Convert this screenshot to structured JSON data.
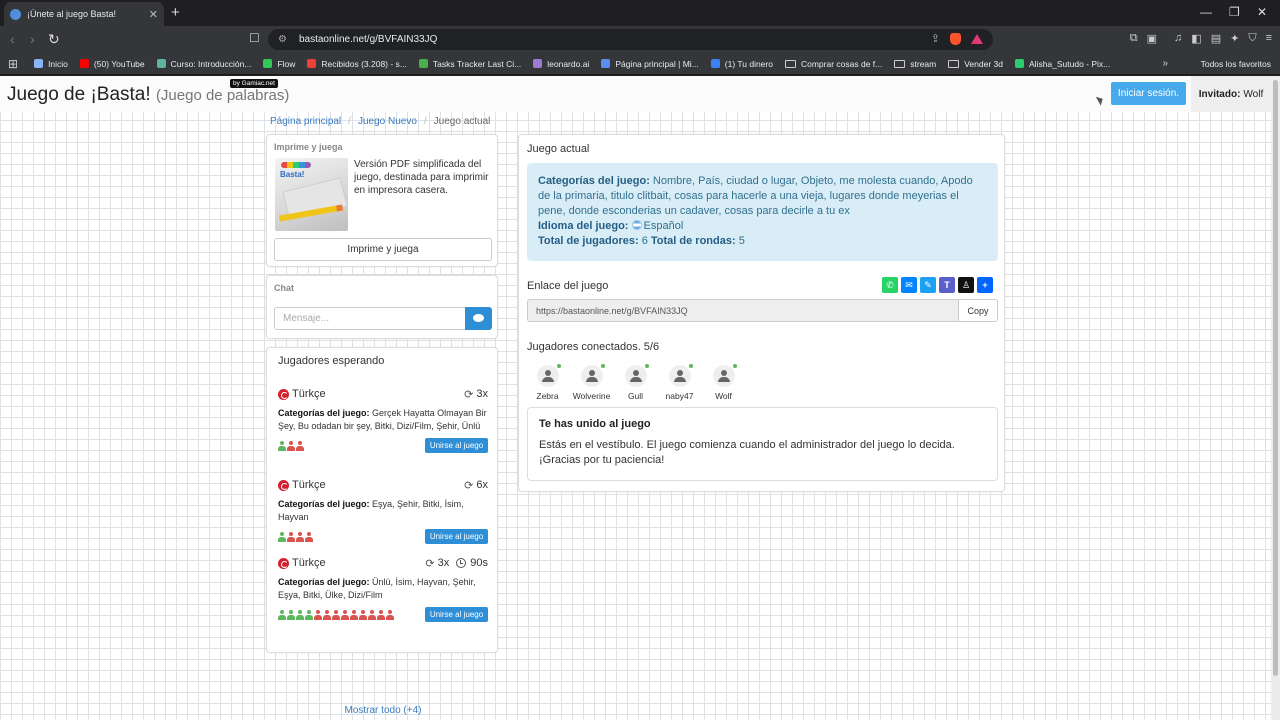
{
  "browser": {
    "tab_title": "¡Únete al juego Basta!",
    "url": "bastaonline.net/g/BVFAIN33JQ",
    "bookmarks": [
      {
        "label": "Inicio",
        "color": "#8ab4f8"
      },
      {
        "label": "(50) YouTube",
        "color": "#ff0000"
      },
      {
        "label": "Curso: Introducción...",
        "color": "#5fb3a1"
      },
      {
        "label": "Flow",
        "color": "#34c759"
      },
      {
        "label": "Recibidos (3.208) - s...",
        "color": "#ea4335"
      },
      {
        "label": "Tasks Tracker Last Ci...",
        "color": "#4caf50"
      },
      {
        "label": "leonardo.ai",
        "color": "#9b7bd4"
      },
      {
        "label": "Página principal | Mi...",
        "color": "#5b8def"
      },
      {
        "label": "(1) Tu dinero",
        "color": "#3b82f6"
      },
      {
        "label": "Comprar cosas de f...",
        "color": ""
      },
      {
        "label": "stream",
        "color": ""
      },
      {
        "label": "Vender 3d",
        "color": ""
      },
      {
        "label": "Alisha_Sutudo - Pix...",
        "color": "#2ecc71"
      }
    ],
    "all_bookmarks": "Todos los favoritos"
  },
  "header": {
    "title": "Juego de ¡Basta!",
    "subtitle": "(Juego de palabras)",
    "badge": "by Gamiac.net",
    "login_label": "Iniciar sesión.",
    "guest_label": "Invitado:",
    "guest_name": "Wolf"
  },
  "breadcrumb": {
    "home": "Página principal",
    "new_game": "Juego Nuevo",
    "current": "Juego actual"
  },
  "print_panel": {
    "title": "Imprime y juega",
    "description": "Versión PDF simplificada del juego, destinada para imprimir en impresora casera.",
    "button_label": "Imprime y juega",
    "image_word": "Basta!"
  },
  "chat": {
    "title": "Chat",
    "placeholder": "Mensaje..."
  },
  "waiting": {
    "title": "Jugadores esperando",
    "categories_label": "Categorías del juego:",
    "join_label": "Unirse al juego",
    "show_all": "Mostrar todo (+4)",
    "games": [
      {
        "language": "Türkçe",
        "rounds": "3x",
        "time": "",
        "categories": "Gerçek Hayatta Olmayan Bir Şey, Bu odadan bir şey, Bitki, Dizi/Film, Şehir, Ünlü",
        "joined": 1,
        "total": 3
      },
      {
        "language": "Türkçe",
        "rounds": "6x",
        "time": "",
        "categories": "Eşya, Şehir, Bitki, İsim, Hayvan",
        "joined": 1,
        "total": 4
      },
      {
        "language": "Türkçe",
        "rounds": "3x",
        "time": "90s",
        "categories": "Ünlü, İsim, Hayvan, Şehir, Eşya, Bitki, Ülke, Dizi/Film",
        "joined": 4,
        "total": 13
      }
    ]
  },
  "current_game": {
    "title": "Juego actual",
    "categories_label": "Categorías del juego:",
    "categories": "Nombre, País, ciudad o lugar, Objeto, me molesta cuando, Apodo de la primaria, titulo clitbait, cosas para hacerle a una vieja, lugares donde meyerias el pene, donde esconderias un cadaver, cosas para decirle a tu ex",
    "language_label": "Idioma del juego:",
    "language": "Español",
    "players_label": "Total de jugadores:",
    "players_total": "6",
    "rounds_label": "Total de rondas:",
    "rounds_total": "5",
    "link_label": "Enlace del juego",
    "link": "https://bastaonline.net/g/BVFAIN33JQ",
    "copy_label": "Copy",
    "connected_label": "Jugadores conectados. 5/6",
    "players": [
      {
        "name": "Zebra"
      },
      {
        "name": "Wolverine"
      },
      {
        "name": "Gull"
      },
      {
        "name": "naby47"
      },
      {
        "name": "Wolf"
      }
    ],
    "lobby_title": "Te has unido al juego",
    "lobby_text": "Estás en el vestíbulo. El juego comienza cuando el administrador del juego lo decida. ¡Gracias por tu paciencia!"
  },
  "colors": {
    "primary": "#2e8fd6",
    "info_bg": "#d9edf7",
    "info_text": "#31708f",
    "link": "#3a7bbf",
    "player_joined": "#5cb85c",
    "player_empty": "#d9534f"
  }
}
